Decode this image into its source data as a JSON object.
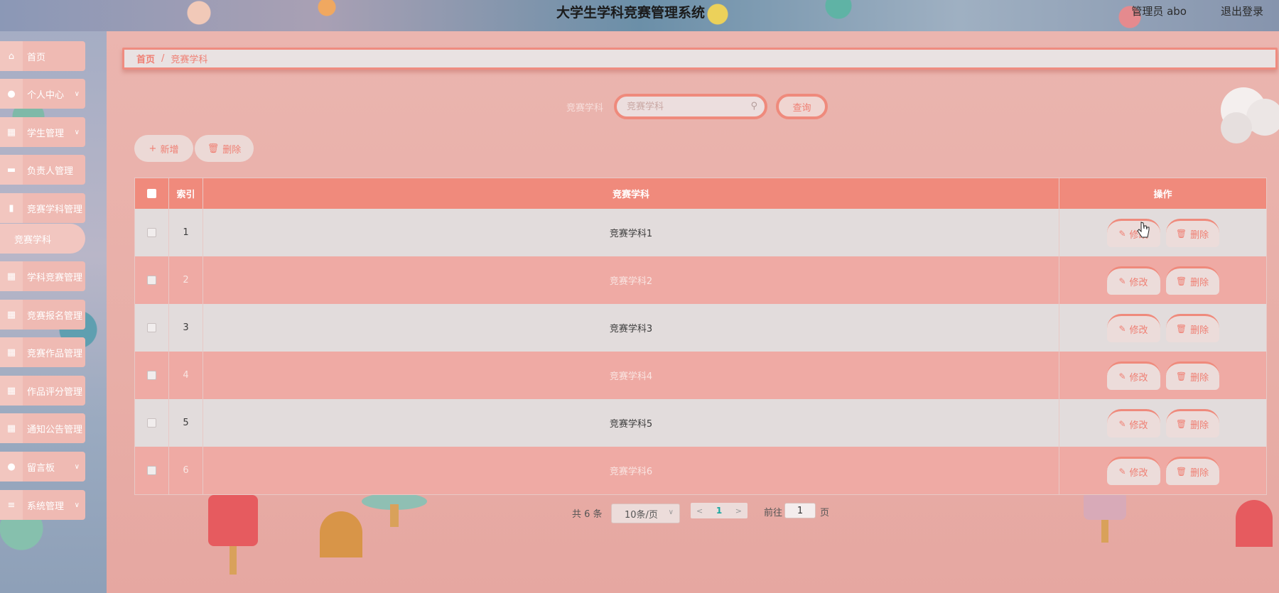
{
  "header": {
    "title": "大学生学科竞赛管理系统",
    "user": "管理员 abo",
    "logout": "退出登录"
  },
  "sidebar": {
    "items": [
      {
        "label": "首页",
        "icon": "home-icon",
        "chevron": false
      },
      {
        "label": "个人中心",
        "icon": "user-icon",
        "chevron": true
      },
      {
        "label": "学生管理",
        "icon": "grid-icon",
        "chevron": true
      },
      {
        "label": "负责人管理",
        "icon": "ticket-icon",
        "chevron": false
      },
      {
        "label": "竞赛学科管理",
        "icon": "clipboard-icon",
        "chevron": false
      },
      {
        "label": "学科竞赛管理",
        "icon": "grid-icon",
        "chevron": false
      },
      {
        "label": "竞赛报名管理",
        "icon": "grid-icon",
        "chevron": false
      },
      {
        "label": "竞赛作品管理",
        "icon": "grid-icon",
        "chevron": false
      },
      {
        "label": "作品评分管理",
        "icon": "grid-icon",
        "chevron": false
      },
      {
        "label": "通知公告管理",
        "icon": "grid-icon",
        "chevron": false
      },
      {
        "label": "留言板",
        "icon": "pin-icon",
        "chevron": true
      },
      {
        "label": "系统管理",
        "icon": "menu-icon",
        "chevron": true
      }
    ],
    "submenu": {
      "label": "竞赛学科"
    }
  },
  "breadcrumb": {
    "home": "首页",
    "separator": "/",
    "current": "竞赛学科"
  },
  "search": {
    "label": "竞赛学科",
    "placeholder": "竞赛学科",
    "button": "查询"
  },
  "actions": {
    "add": "新增",
    "delete": "删除"
  },
  "table": {
    "headers": {
      "index": "索引",
      "subject": "竞赛学科",
      "ops": "操作"
    },
    "rows": [
      {
        "index": "1",
        "subject": "竞赛学科1"
      },
      {
        "index": "2",
        "subject": "竞赛学科2"
      },
      {
        "index": "3",
        "subject": "竞赛学科3"
      },
      {
        "index": "4",
        "subject": "竞赛学科4"
      },
      {
        "index": "5",
        "subject": "竞赛学科5"
      },
      {
        "index": "6",
        "subject": "竞赛学科6"
      }
    ],
    "edit_label": "修改",
    "delete_label": "删除"
  },
  "pagination": {
    "total": "共 6 条",
    "page_size": "10条/页",
    "current_page": "1",
    "goto_prefix": "前往",
    "goto_value": "1",
    "goto_suffix": "页"
  },
  "colors": {
    "accent": "#ef8a7c",
    "header_row": "#f08a7c",
    "row_alt": "#efaaa4",
    "row_plain": "#e2dcdc",
    "pager_active": "#1aa7a0"
  }
}
